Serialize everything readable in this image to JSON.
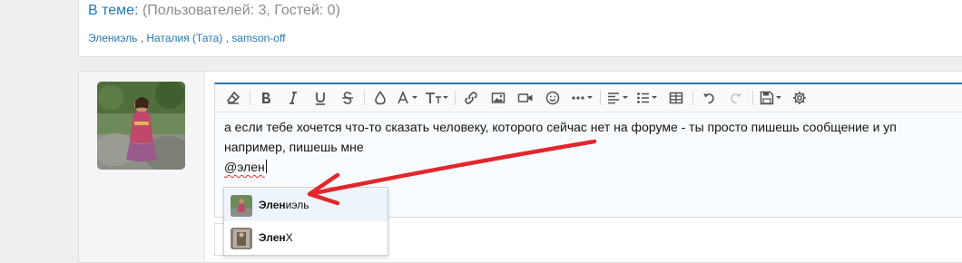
{
  "topic_info": {
    "label": "В теме:",
    "stats": "(Пользователей: 3, Гостей: 0)",
    "users": [
      "Элениэль",
      "Наталия (Тата)",
      "samson-off"
    ],
    "separator": " , "
  },
  "editor": {
    "toolbar": {
      "text_size_glyph": "T↕"
    },
    "lines": [
      "а если тебе хочется что-то сказать человеку, которого сейчас нет на форуме - ты просто пишешь сообщение и уп",
      "например, пишешь мне"
    ],
    "typed_mention": "@элен"
  },
  "mention_suggestions": [
    {
      "match": "Элен",
      "rest": "иэль",
      "active": true
    },
    {
      "match": "Элен",
      "rest": "X",
      "active": false
    }
  ],
  "colors": {
    "accent": "#2577b1",
    "annotation_arrow": "#e3262d"
  }
}
